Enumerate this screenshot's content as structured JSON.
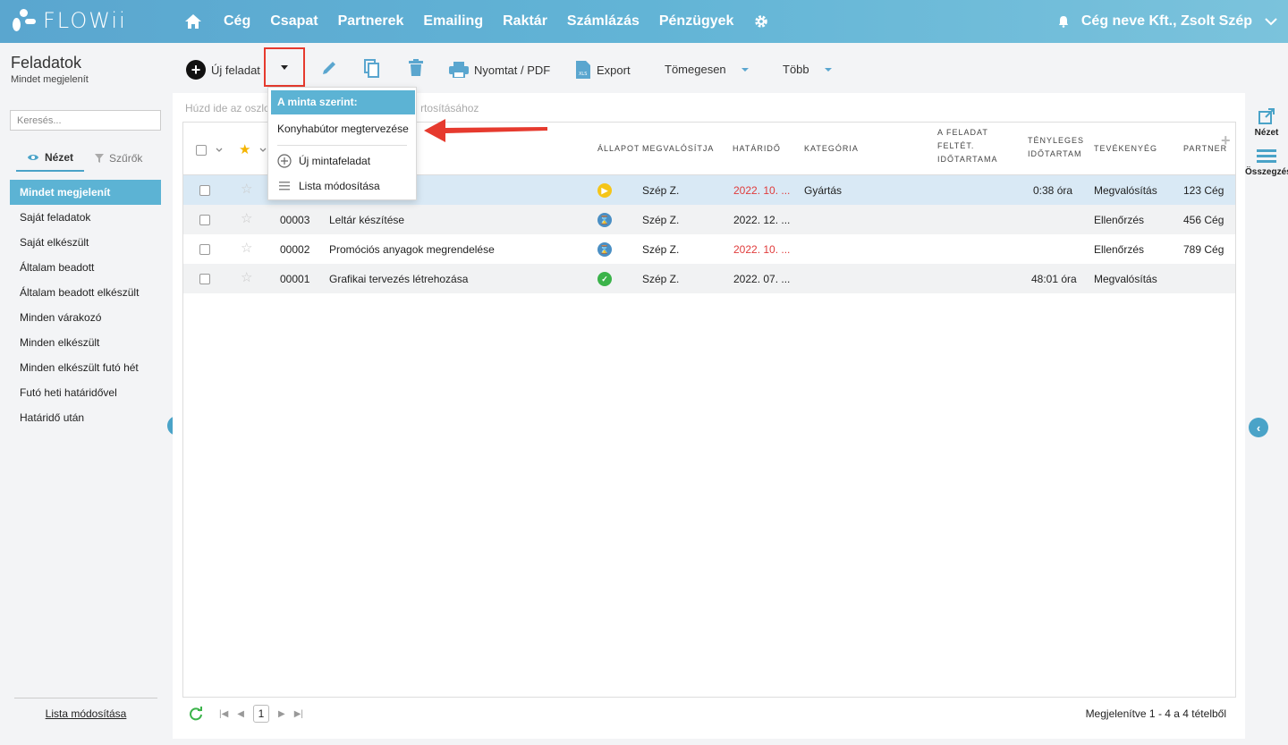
{
  "brand": {
    "name": "FLOWii"
  },
  "nav": {
    "items": [
      "Cég",
      "Csapat",
      "Partnerek",
      "Emailing",
      "Raktár",
      "Számlázás",
      "Pénzügyek"
    ]
  },
  "user": {
    "label": "Cég neve Kft., Zsolt Szép"
  },
  "page": {
    "title": "Feladatok",
    "subtitle": "Mindet megjelenít"
  },
  "toolbar": {
    "new_task": "Új feladat",
    "print": "Nyomtat / PDF",
    "export": "Export",
    "bulk": "Tömegesen",
    "more": "Több"
  },
  "sidebar": {
    "search_placeholder": "Keresés...",
    "tab_view": "Nézet",
    "tab_filters": "Szűrők",
    "items": [
      "Mindet megjelenít",
      "Saját feladatok",
      "Saját elkészült",
      "Általam beadott",
      "Általam beadott elkészült",
      "Minden várakozó",
      "Minden elkészült",
      "Minden elkészült futó hét",
      "Futó heti határidővel",
      "Határidő után"
    ],
    "footer": "Lista módosítása"
  },
  "grid": {
    "group_hint_left": "Húzd ide az oszlo",
    "group_hint_right": "rtosításához",
    "headers": {
      "status": "ÁLLAPOT",
      "owner": "MEGVALÓSÍTJA",
      "deadline": "HATÁRIDŐ",
      "category": "KATEGÓRIA",
      "planned": [
        "A FELADAT",
        "FELTÉT.",
        "IDŐTARTAMA"
      ],
      "actual": [
        "TÉNYLEGES",
        "IDŐTARTAM"
      ],
      "activity": "TEVÉKENYÉG",
      "partner": "PARTNER"
    },
    "rows": [
      {
        "id": "",
        "name": "",
        "status": "in-progress",
        "owner": "Szép Z.",
        "deadline": "2022. 10. ...",
        "overdue": true,
        "category": "Gyártás",
        "actual": "0:38 óra",
        "activity": "Megvalósítás",
        "partner": "123 Cég"
      },
      {
        "id": "00003",
        "name": "Leltár készítése",
        "status": "waiting",
        "owner": "Szép Z.",
        "deadline": "2022. 12. ...",
        "overdue": false,
        "category": "",
        "actual": "",
        "activity": "Ellenőrzés",
        "partner": "456 Cég"
      },
      {
        "id": "00002",
        "name": "Promóciós anyagok megrendelése",
        "status": "waiting",
        "owner": "Szép Z.",
        "deadline": "2022. 10. ...",
        "overdue": true,
        "category": "",
        "actual": "",
        "activity": "Ellenőrzés",
        "partner": "789 Cég"
      },
      {
        "id": "00001",
        "name": "Grafikai tervezés létrehozása",
        "status": "done",
        "owner": "Szép Z.",
        "deadline": "2022. 07. ...",
        "overdue": false,
        "category": "",
        "actual": "48:01 óra",
        "activity": "Megvalósítás",
        "partner": ""
      }
    ],
    "page_number": "1",
    "footer_info": "Megjelenítve 1 - 4 a 4 tételből"
  },
  "rail": {
    "view": "Nézet",
    "summary": "Összegzés"
  },
  "dropdown": {
    "header": "A minta szerint:",
    "template": "Konyhabútor megtervezése",
    "new_template": "Új mintafeladat",
    "edit_list": "Lista módosítása"
  },
  "colors": {
    "accent": "#5cb3d4",
    "highlight": "#e63a2e",
    "overdue": "#e03c3c"
  }
}
